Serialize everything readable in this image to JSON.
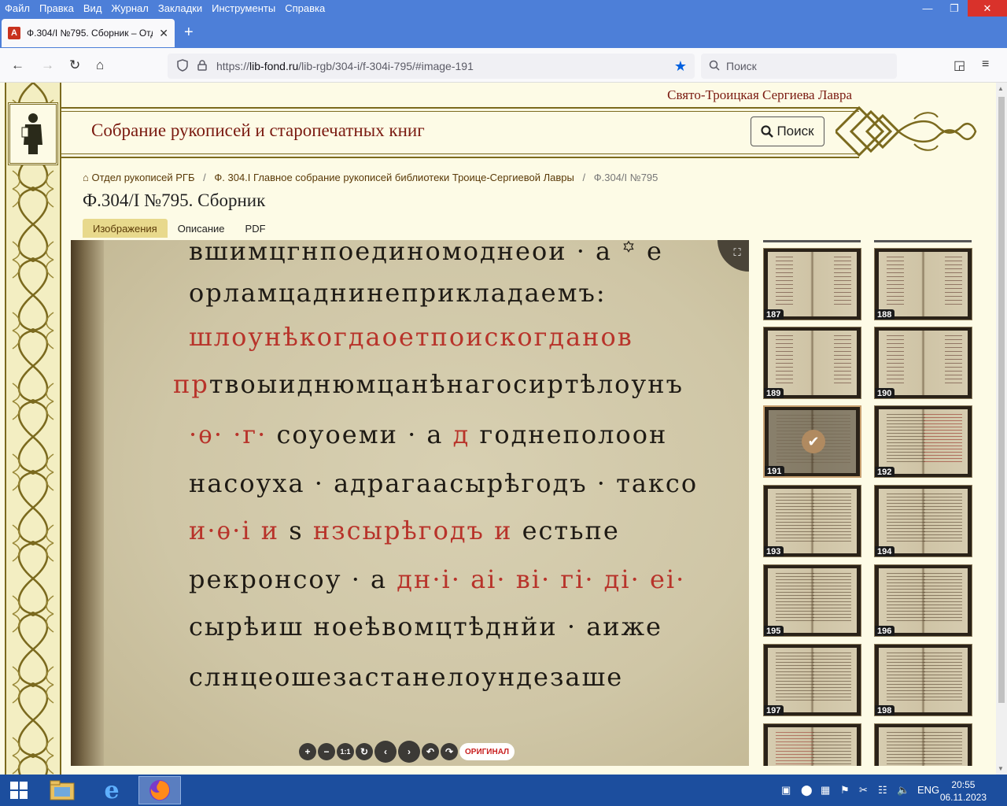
{
  "menu": [
    "Файл",
    "Правка",
    "Вид",
    "Журнал",
    "Закладки",
    "Инструменты",
    "Справка"
  ],
  "menu_accels": [
    "Ф",
    "П",
    "В",
    "Ж",
    "З",
    "И",
    "С"
  ],
  "window_controls": {
    "minimize": "—",
    "restore": "❐",
    "close": "✕"
  },
  "tab": {
    "title": "Ф.304/I №795. Сборник – Отдел рукописей",
    "favicon_letter": "A",
    "close": "✕",
    "new_tab": "+"
  },
  "nav": {
    "back": "←",
    "forward": "→",
    "reload": "↻",
    "home": "⌂"
  },
  "url": {
    "prefix": "https://",
    "domain": "lib-fond.ru",
    "path": "/lib-rgb/304-i/f-304i-795/#image-191"
  },
  "search_placeholder": "Поиск",
  "toolbar_right": {
    "pocket": "◲",
    "menu": "≡"
  },
  "site": {
    "lavra": "Свято-Троицкая Сергиева Лавра",
    "title": "Собрание рукописей и старопечатных книг",
    "search_button": "Поиск"
  },
  "breadcrumbs": [
    "Отдел рукописей РГБ",
    "Ф. 304.I Главное собрание рукописей библиотеки Троице-Сергиевой Лавры",
    "Ф.304/I №795"
  ],
  "doc_title": "Ф.304/I №795. Сборник",
  "doc_tabs": [
    "Изображения",
    "Описание",
    "PDF"
  ],
  "active_tab": "Изображения",
  "manuscript_lines": [
    {
      "black": "вшимцгнпоединомоднеои · а ꙳ е",
      "red": ""
    },
    {
      "black": "орламцаднинеприкладаемъ:",
      "red": ""
    },
    {
      "black": "",
      "red": "шлоунѣкогдаоетпоискогданов"
    },
    {
      "black": "твоыиднюмцанѣнагосиртѣлоунъ",
      "red": "пр"
    },
    {
      "black": "соуоеми · а",
      "red": "·ѳ· ·г·",
      "red2": "д",
      "black2": "годнеполоон"
    },
    {
      "black": "насоуха · адрагаасырѣгодъ · таксо",
      "red": ""
    },
    {
      "black": "и·ѳ·і и",
      "red": "ѕ",
      "black2": "нзсырѣгодъ",
      "red2": "и",
      "black3": "естьпе"
    },
    {
      "black": "рекронсоу · а",
      "red": "дн·і· аі· ві· гі· ді· еі·"
    },
    {
      "black": "сырѣиш ноеѣвомцтѣднйи · аиже",
      "red": ""
    },
    {
      "black": "слнцеошезастанелоундезаше",
      "red": ""
    }
  ],
  "viewer_controls": [
    "+",
    "−",
    "1:1",
    "↻",
    "‹",
    "›",
    "↶",
    "↷"
  ],
  "viewer_original_label": "ОРИГИНАЛ",
  "fullscreen_icon": "⛶",
  "thumbnails": [
    {
      "num": "187",
      "style": "list"
    },
    {
      "num": "188",
      "style": "list"
    },
    {
      "num": "189",
      "style": "list"
    },
    {
      "num": "190",
      "style": "list"
    },
    {
      "num": "191",
      "style": "selected"
    },
    {
      "num": "192",
      "style": "text"
    },
    {
      "num": "193",
      "style": "text"
    },
    {
      "num": "194",
      "style": "text"
    },
    {
      "num": "195",
      "style": "text"
    },
    {
      "num": "196",
      "style": "text"
    },
    {
      "num": "197",
      "style": "text"
    },
    {
      "num": "198",
      "style": "text"
    },
    {
      "num": "",
      "style": "text"
    },
    {
      "num": "",
      "style": "text"
    }
  ],
  "selected_thumbnail": "191",
  "taskbar": {
    "lang": "ENG",
    "time": "20:55",
    "date": "06.11.2023"
  },
  "colors": {
    "titlebar": "#4d7fd8",
    "accent_red": "#7a1a10",
    "taskbar": "#1c4e9e",
    "page_bg": "#fdfbe6"
  }
}
